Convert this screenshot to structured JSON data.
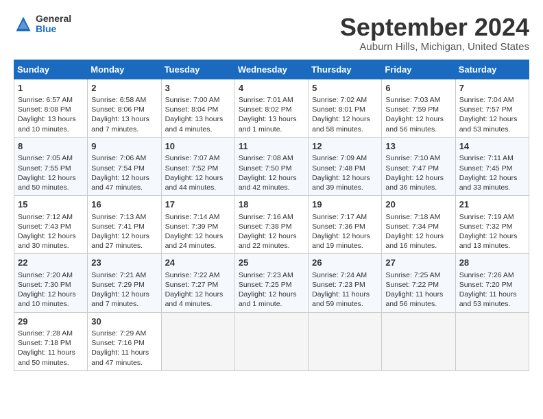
{
  "header": {
    "logo_general": "General",
    "logo_blue": "Blue",
    "month_title": "September 2024",
    "location": "Auburn Hills, Michigan, United States"
  },
  "days_of_week": [
    "Sunday",
    "Monday",
    "Tuesday",
    "Wednesday",
    "Thursday",
    "Friday",
    "Saturday"
  ],
  "weeks": [
    [
      {
        "day": "1",
        "lines": [
          "Sunrise: 6:57 AM",
          "Sunset: 8:08 PM",
          "Daylight: 13 hours",
          "and 10 minutes."
        ]
      },
      {
        "day": "2",
        "lines": [
          "Sunrise: 6:58 AM",
          "Sunset: 8:06 PM",
          "Daylight: 13 hours",
          "and 7 minutes."
        ]
      },
      {
        "day": "3",
        "lines": [
          "Sunrise: 7:00 AM",
          "Sunset: 8:04 PM",
          "Daylight: 13 hours",
          "and 4 minutes."
        ]
      },
      {
        "day": "4",
        "lines": [
          "Sunrise: 7:01 AM",
          "Sunset: 8:02 PM",
          "Daylight: 13 hours",
          "and 1 minute."
        ]
      },
      {
        "day": "5",
        "lines": [
          "Sunrise: 7:02 AM",
          "Sunset: 8:01 PM",
          "Daylight: 12 hours",
          "and 58 minutes."
        ]
      },
      {
        "day": "6",
        "lines": [
          "Sunrise: 7:03 AM",
          "Sunset: 7:59 PM",
          "Daylight: 12 hours",
          "and 56 minutes."
        ]
      },
      {
        "day": "7",
        "lines": [
          "Sunrise: 7:04 AM",
          "Sunset: 7:57 PM",
          "Daylight: 12 hours",
          "and 53 minutes."
        ]
      }
    ],
    [
      {
        "day": "8",
        "lines": [
          "Sunrise: 7:05 AM",
          "Sunset: 7:55 PM",
          "Daylight: 12 hours",
          "and 50 minutes."
        ]
      },
      {
        "day": "9",
        "lines": [
          "Sunrise: 7:06 AM",
          "Sunset: 7:54 PM",
          "Daylight: 12 hours",
          "and 47 minutes."
        ]
      },
      {
        "day": "10",
        "lines": [
          "Sunrise: 7:07 AM",
          "Sunset: 7:52 PM",
          "Daylight: 12 hours",
          "and 44 minutes."
        ]
      },
      {
        "day": "11",
        "lines": [
          "Sunrise: 7:08 AM",
          "Sunset: 7:50 PM",
          "Daylight: 12 hours",
          "and 42 minutes."
        ]
      },
      {
        "day": "12",
        "lines": [
          "Sunrise: 7:09 AM",
          "Sunset: 7:48 PM",
          "Daylight: 12 hours",
          "and 39 minutes."
        ]
      },
      {
        "day": "13",
        "lines": [
          "Sunrise: 7:10 AM",
          "Sunset: 7:47 PM",
          "Daylight: 12 hours",
          "and 36 minutes."
        ]
      },
      {
        "day": "14",
        "lines": [
          "Sunrise: 7:11 AM",
          "Sunset: 7:45 PM",
          "Daylight: 12 hours",
          "and 33 minutes."
        ]
      }
    ],
    [
      {
        "day": "15",
        "lines": [
          "Sunrise: 7:12 AM",
          "Sunset: 7:43 PM",
          "Daylight: 12 hours",
          "and 30 minutes."
        ]
      },
      {
        "day": "16",
        "lines": [
          "Sunrise: 7:13 AM",
          "Sunset: 7:41 PM",
          "Daylight: 12 hours",
          "and 27 minutes."
        ]
      },
      {
        "day": "17",
        "lines": [
          "Sunrise: 7:14 AM",
          "Sunset: 7:39 PM",
          "Daylight: 12 hours",
          "and 24 minutes."
        ]
      },
      {
        "day": "18",
        "lines": [
          "Sunrise: 7:16 AM",
          "Sunset: 7:38 PM",
          "Daylight: 12 hours",
          "and 22 minutes."
        ]
      },
      {
        "day": "19",
        "lines": [
          "Sunrise: 7:17 AM",
          "Sunset: 7:36 PM",
          "Daylight: 12 hours",
          "and 19 minutes."
        ]
      },
      {
        "day": "20",
        "lines": [
          "Sunrise: 7:18 AM",
          "Sunset: 7:34 PM",
          "Daylight: 12 hours",
          "and 16 minutes."
        ]
      },
      {
        "day": "21",
        "lines": [
          "Sunrise: 7:19 AM",
          "Sunset: 7:32 PM",
          "Daylight: 12 hours",
          "and 13 minutes."
        ]
      }
    ],
    [
      {
        "day": "22",
        "lines": [
          "Sunrise: 7:20 AM",
          "Sunset: 7:30 PM",
          "Daylight: 12 hours",
          "and 10 minutes."
        ]
      },
      {
        "day": "23",
        "lines": [
          "Sunrise: 7:21 AM",
          "Sunset: 7:29 PM",
          "Daylight: 12 hours",
          "and 7 minutes."
        ]
      },
      {
        "day": "24",
        "lines": [
          "Sunrise: 7:22 AM",
          "Sunset: 7:27 PM",
          "Daylight: 12 hours",
          "and 4 minutes."
        ]
      },
      {
        "day": "25",
        "lines": [
          "Sunrise: 7:23 AM",
          "Sunset: 7:25 PM",
          "Daylight: 12 hours",
          "and 1 minute."
        ]
      },
      {
        "day": "26",
        "lines": [
          "Sunrise: 7:24 AM",
          "Sunset: 7:23 PM",
          "Daylight: 11 hours",
          "and 59 minutes."
        ]
      },
      {
        "day": "27",
        "lines": [
          "Sunrise: 7:25 AM",
          "Sunset: 7:22 PM",
          "Daylight: 11 hours",
          "and 56 minutes."
        ]
      },
      {
        "day": "28",
        "lines": [
          "Sunrise: 7:26 AM",
          "Sunset: 7:20 PM",
          "Daylight: 11 hours",
          "and 53 minutes."
        ]
      }
    ],
    [
      {
        "day": "29",
        "lines": [
          "Sunrise: 7:28 AM",
          "Sunset: 7:18 PM",
          "Daylight: 11 hours",
          "and 50 minutes."
        ]
      },
      {
        "day": "30",
        "lines": [
          "Sunrise: 7:29 AM",
          "Sunset: 7:16 PM",
          "Daylight: 11 hours",
          "and 47 minutes."
        ]
      },
      {
        "day": "",
        "lines": []
      },
      {
        "day": "",
        "lines": []
      },
      {
        "day": "",
        "lines": []
      },
      {
        "day": "",
        "lines": []
      },
      {
        "day": "",
        "lines": []
      }
    ]
  ]
}
